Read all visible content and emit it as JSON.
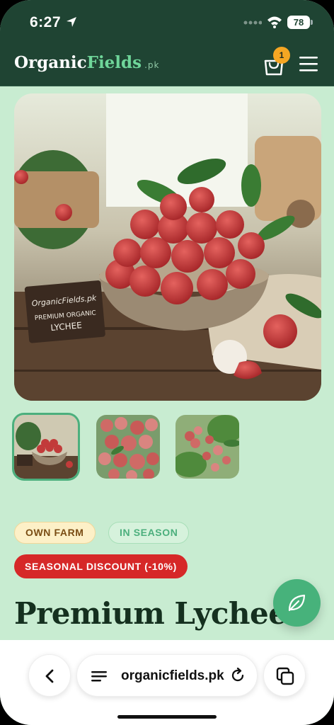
{
  "status_bar": {
    "time": "6:27",
    "battery": "78"
  },
  "header": {
    "logo_part1": "Organic",
    "logo_part2": "Fields",
    "logo_suffix": ".pk",
    "cart_count": "1"
  },
  "gallery": {
    "hero_sign_line1": "OrganicFields.pk",
    "hero_sign_line2": "PREMIUM ORGANIC",
    "hero_sign_line3": "LYCHEE",
    "thumbnails": [
      "thumb-1",
      "thumb-2",
      "thumb-3"
    ],
    "active_thumbnail": 0
  },
  "product": {
    "tags": [
      "OWN FARM",
      "IN SEASON"
    ],
    "discount_badge": "SEASONAL DISCOUNT (-10%)",
    "title": "Premium Lychee"
  },
  "browser": {
    "url": "organicfields.pk"
  },
  "colors": {
    "header_bg": "#1f4433",
    "page_bg": "#c8ecd1",
    "accent_green": "#47b27b",
    "discount_red": "#d62828",
    "badge_orange": "#f5a623"
  }
}
